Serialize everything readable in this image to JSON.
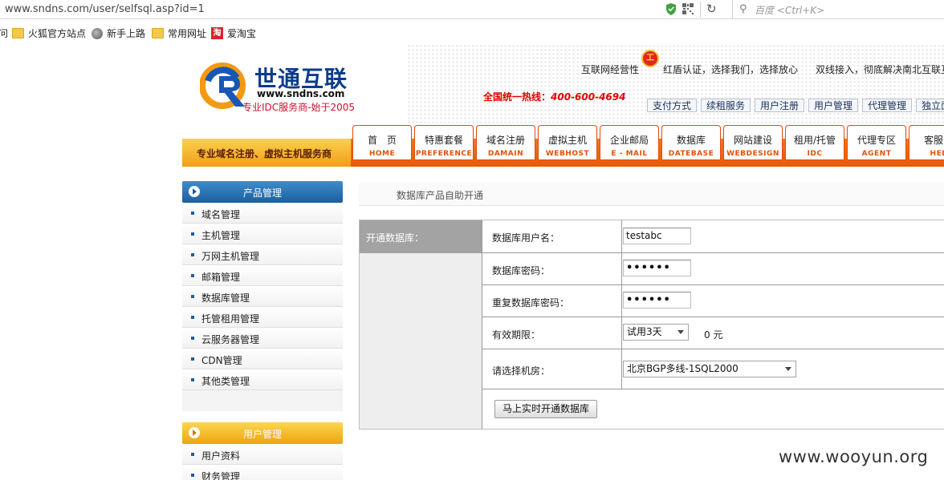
{
  "browser": {
    "url": "www.sndns.com/user/selfsql.asp?id=1",
    "search_placeholder": "百度 <Ctrl+K>",
    "icons": [
      "shield-icon",
      "qr-icon",
      "reload-icon",
      "search-icon"
    ]
  },
  "bookmarks": {
    "partial": "问",
    "items": [
      {
        "label": "火狐官方站点",
        "icon": "folder-icon"
      },
      {
        "label": "新手上路",
        "icon": "globe-icon"
      },
      {
        "label": "常用网址",
        "icon": "folder-icon"
      },
      {
        "label": "爱淘宝",
        "icon": "taobao-icon",
        "icon_glyph": "淘"
      }
    ]
  },
  "header": {
    "logo_name": "世通互联",
    "logo_url": "www.sndns.com",
    "logo_tagline": "专业IDC服务商-始于2005",
    "icp_text": "互联网经营性",
    "badge_glyph": "工",
    "cert_text": "红盾认证，选择我们，选择放心",
    "dual_line_text": "双线接入，彻底解决南北互联互",
    "hotline_label": "全国统一热线：",
    "hotline_number": "400-600-4694",
    "top_links": [
      "支付方式",
      "续租服务",
      "用户注册",
      "用户管理",
      "代理管理",
      "独立面"
    ],
    "slogan": "专业域名注册、虚拟主机服务商",
    "nav": [
      {
        "cn": "首　页",
        "en": "HOME"
      },
      {
        "cn": "特惠套餐",
        "en": "PREFERENCE"
      },
      {
        "cn": "域名注册",
        "en": "DAMAIN"
      },
      {
        "cn": "虚拟主机",
        "en": "WEBHOST"
      },
      {
        "cn": "企业邮局",
        "en": "E - MAIL"
      },
      {
        "cn": "数据库",
        "en": "DATEBASE"
      },
      {
        "cn": "网站建设",
        "en": "WEBDESIGN"
      },
      {
        "cn": "租用/托管",
        "en": "IDC"
      },
      {
        "cn": "代理专区",
        "en": "AGENT"
      },
      {
        "cn": "客服中",
        "en": "HEL"
      }
    ]
  },
  "sidebar": {
    "product_title": "产品管理",
    "product_items": [
      "域名管理",
      "主机管理",
      "万网主机管理",
      "邮箱管理",
      "数据库管理",
      "托管租用管理",
      "云服务器管理",
      "CDN管理",
      "其他类管理"
    ],
    "user_title": "用户管理",
    "user_items": [
      "用户资料",
      "财务管理"
    ]
  },
  "main": {
    "breadcrumb": "数据库产品自助开通",
    "section_label": "开通数据库：",
    "fields": {
      "username_label": "数据库用户名：",
      "username_value": "testabc",
      "password_label": "数据库密码：",
      "password_value": "••••••",
      "repeat_label": "重复数据库密码：",
      "repeat_value": "••••••",
      "period_label": "有效期限：",
      "period_value": "试用3天",
      "price": "0 元",
      "room_label": "请选择机房：",
      "room_value": "北京BGP多线-1SQL2000"
    },
    "submit_label": "马上实时开通数据库"
  },
  "watermark": "www.wooyun.org",
  "colors": {
    "nav_orange": "#e75a0a",
    "sidebar_blue": "#1b5e9f",
    "sidebar_gold": "#eea312",
    "hotline_red": "#e00000",
    "logo_blue": "#0b3c8c"
  }
}
